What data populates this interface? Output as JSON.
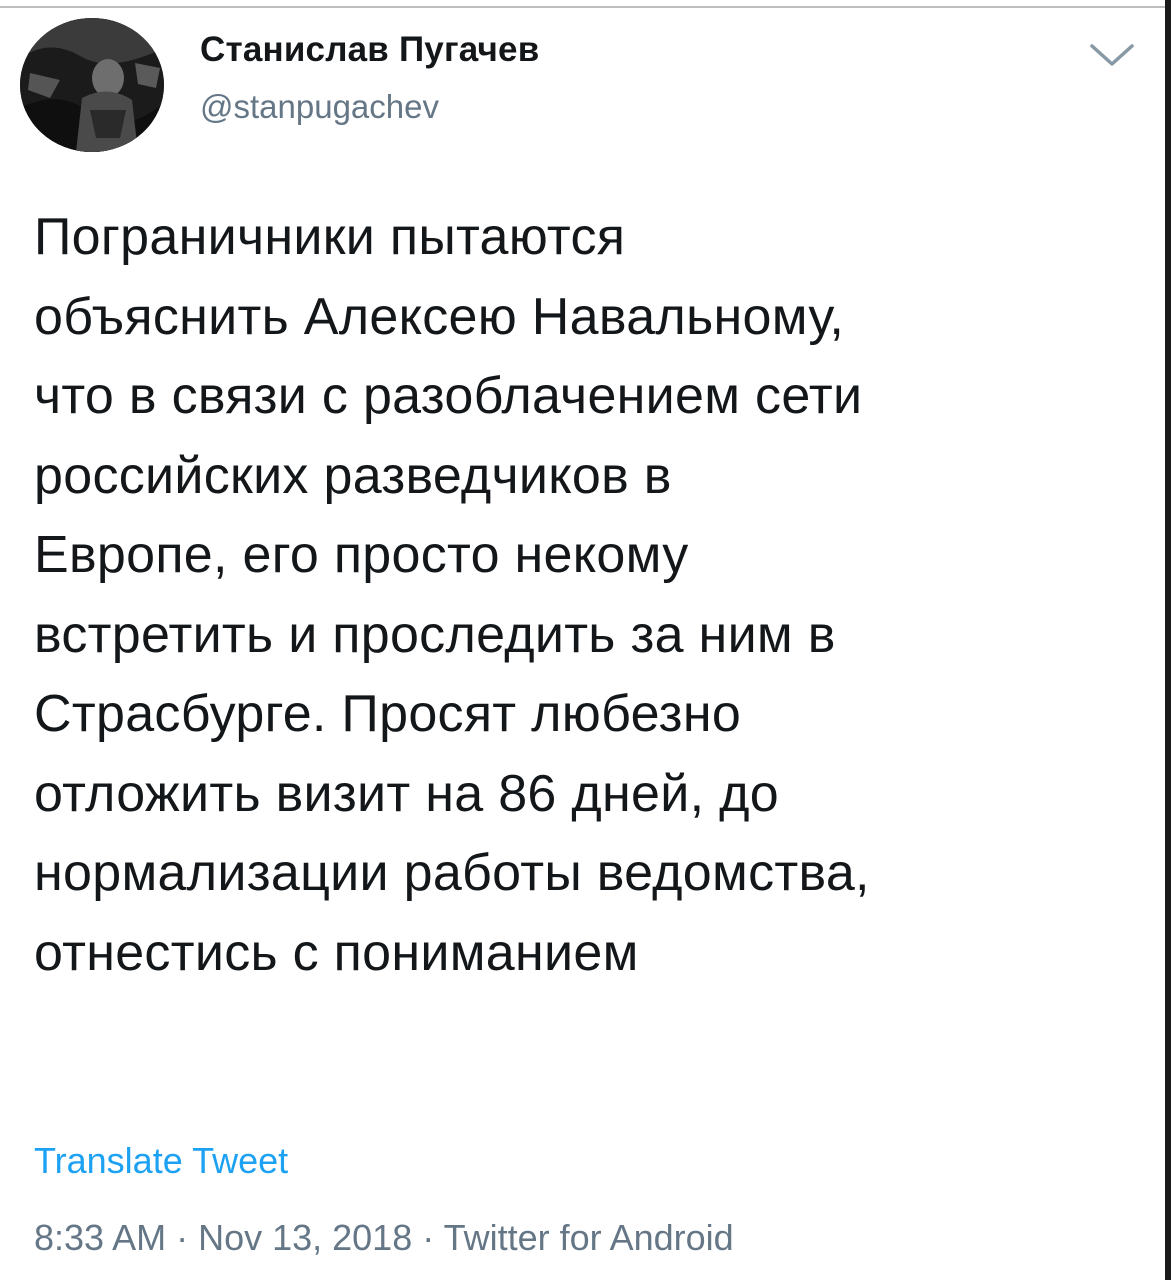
{
  "tweet": {
    "display_name": "Станислав Пугачев",
    "handle": "@stanpugachev",
    "text": "Пограничники пытаются\nобъяснить Алексею Навальному,\nчто в связи с разоблачением сети\nроссийских разведчиков в\nЕвропе, его просто некому\nвстретить и проследить за ним в\nСтрасбурге. Просят любезно\nотложить визит на 86 дней, до\nнормализации работы ведомства,\nотнестись с пониманием",
    "translate_label": "Translate Tweet",
    "meta": "8:33 AM · Nov 13, 2018 · Twitter for Android"
  },
  "icons": {
    "avatar": "avatar-photo",
    "menu": "chevron-down-icon"
  },
  "colors": {
    "text": "#14171a",
    "secondary": "#657786",
    "link": "#1da1f2",
    "background": "#ffffff"
  }
}
